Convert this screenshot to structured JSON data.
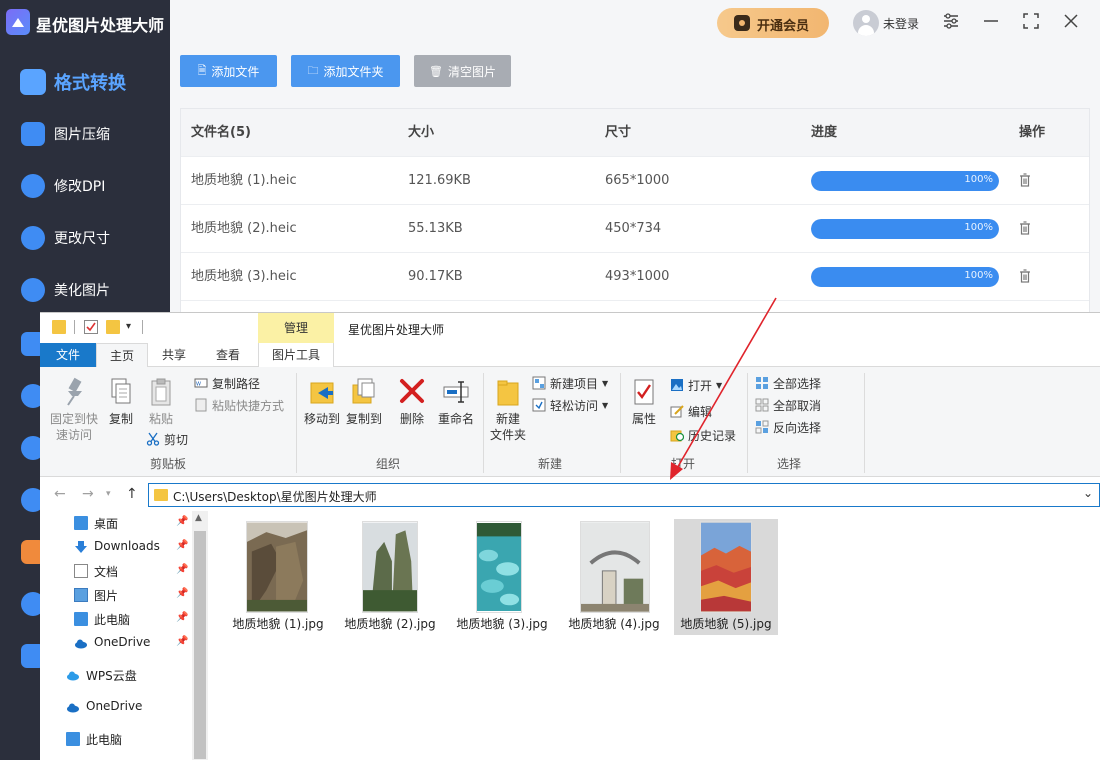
{
  "app": {
    "name": "星优图片处理大师",
    "vip_label": "开通会员",
    "login_label": "未登录"
  },
  "sidebar": {
    "items": [
      {
        "label": "格式转换",
        "icon": "format-convert-icon",
        "active": true
      },
      {
        "label": "图片压缩",
        "icon": "compress-icon"
      },
      {
        "label": "修改DPI",
        "icon": "dpi-icon"
      },
      {
        "label": "更改尺寸",
        "icon": "resize-icon"
      },
      {
        "label": "美化图片",
        "icon": "beautify-icon"
      }
    ]
  },
  "toolbar": {
    "add_file": "添加文件",
    "add_folder": "添加文件夹",
    "clear": "清空图片"
  },
  "table": {
    "headers": {
      "name": "文件名(5)",
      "size": "大小",
      "dim": "尺寸",
      "progress": "进度",
      "op": "操作"
    },
    "rows": [
      {
        "name": "地质地貌 (1).heic",
        "size": "121.69KB",
        "dim": "665*1000",
        "progress_text": "100%",
        "progress": 1.0
      },
      {
        "name": "地质地貌 (2).heic",
        "size": "55.13KB",
        "dim": "450*734",
        "progress_text": "100%",
        "progress": 1.0
      },
      {
        "name": "地质地貌 (3).heic",
        "size": "90.17KB",
        "dim": "493*1000",
        "progress_text": "100%",
        "progress": 1.0
      }
    ]
  },
  "explorer": {
    "manage_tab": "管理",
    "title": "星优图片处理大师",
    "tabs": [
      "文件",
      "主页",
      "共享",
      "查看",
      "图片工具"
    ],
    "ribbon": {
      "pin_quick": [
        "固定到快",
        "速访问"
      ],
      "copy": "复制",
      "paste": "粘贴",
      "copy_path": "复制路径",
      "paste_shortcut": "粘贴快捷方式",
      "cut": "剪切",
      "group_clipboard": "剪贴板",
      "move_to": "移动到",
      "copy_to": "复制到",
      "delete": "删除",
      "rename": "重命名",
      "group_organize": "组织",
      "new_folder": [
        "新建",
        "文件夹"
      ],
      "new_item": "新建项目",
      "easy_access": "轻松访问",
      "group_new": "新建",
      "properties": "属性",
      "open": "打开",
      "edit": "编辑",
      "history": "历史记录",
      "group_open": "打开",
      "select_all": "全部选择",
      "select_none": "全部取消",
      "invert": "反向选择",
      "group_select": "选择"
    },
    "address": "C:\\Users\\Desktop\\星优图片处理大师",
    "nav": [
      {
        "label": "桌面",
        "pinned": true
      },
      {
        "label": "Downloads",
        "pinned": true
      },
      {
        "label": "文档",
        "pinned": true
      },
      {
        "label": "图片",
        "pinned": true
      },
      {
        "label": "此电脑",
        "pinned": true
      },
      {
        "label": "OneDrive",
        "pinned": true
      },
      {
        "label": "WPS云盘"
      },
      {
        "label": "OneDrive"
      },
      {
        "label": "此电脑"
      }
    ],
    "files": [
      {
        "name": "地质地貌 (1).jpg"
      },
      {
        "name": "地质地貌 (2).jpg"
      },
      {
        "name": "地质地貌 (3).jpg"
      },
      {
        "name": "地质地貌 (4).jpg"
      },
      {
        "name": "地质地貌 (5).jpg",
        "selected": true
      }
    ]
  }
}
